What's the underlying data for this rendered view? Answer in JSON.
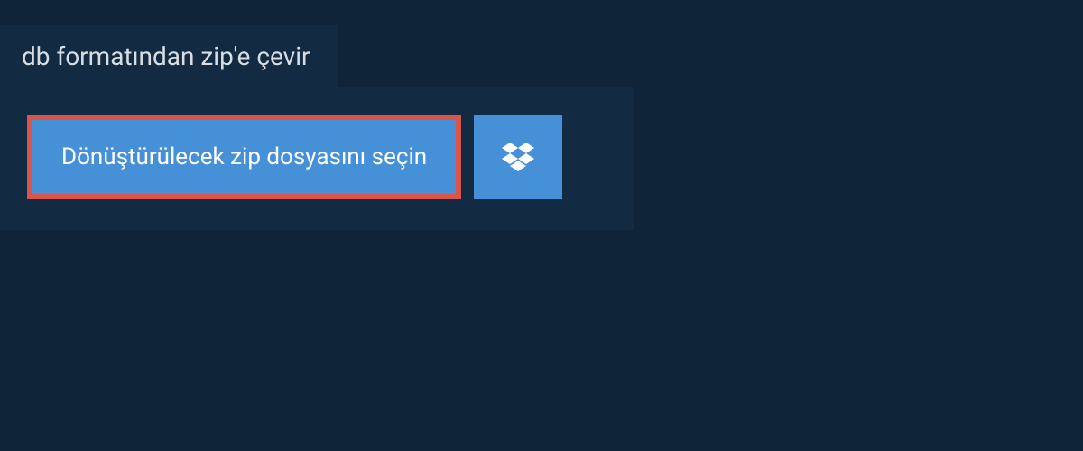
{
  "header": {
    "title": "db formatından zip'e çevir"
  },
  "panel": {
    "select_button_label": "Dönüştürülecek zip dosyasını seçin",
    "dropbox_icon": "dropbox"
  },
  "colors": {
    "page_bg": "#0f2438",
    "panel_bg": "#122b42",
    "button_bg": "#4690d8",
    "button_border": "#da5449",
    "text_light": "#ffffff",
    "title_text": "#d8dde2"
  }
}
